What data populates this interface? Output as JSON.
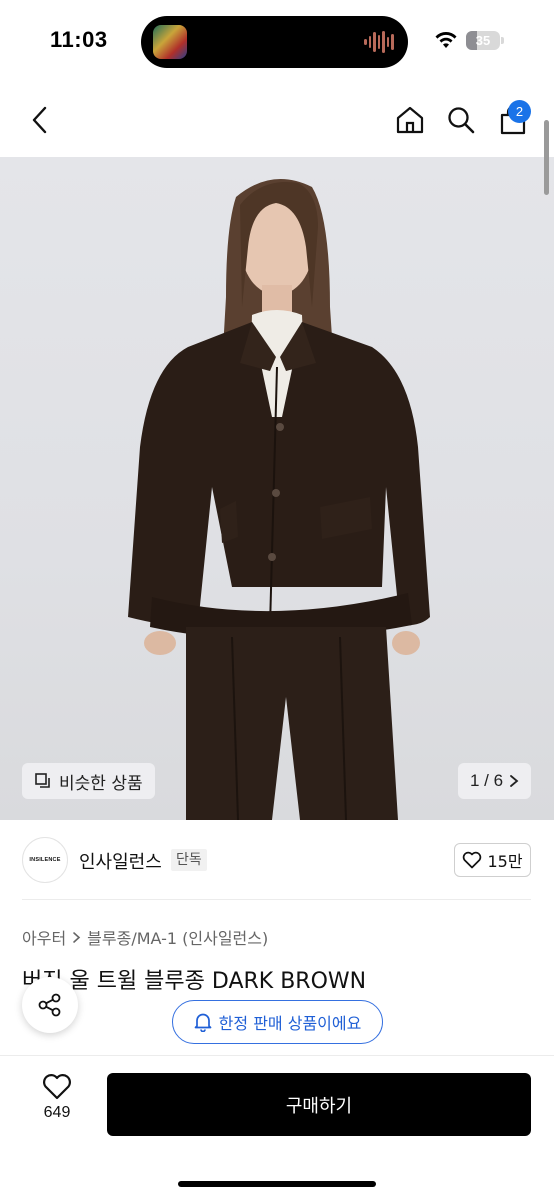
{
  "status_bar": {
    "time": "11:03",
    "battery": "35"
  },
  "nav": {
    "cart_count": "2"
  },
  "gallery": {
    "similar_label": "비슷한 상품",
    "page_indicator": "1 / 6"
  },
  "brand": {
    "logo_text": "INSILENCE",
    "name": "인사일런스",
    "badge": "단독",
    "likes": "15만"
  },
  "product": {
    "breadcrumb": [
      "아우터",
      "블루종/MA-1 (인사일런스)"
    ],
    "title": "버진 울 트윌 블루종 DARK BROWN"
  },
  "limited_notice": "한정 판매 상품이에요",
  "bottom": {
    "wish_count": "649",
    "buy_label": "구매하기"
  },
  "colors": {
    "accent": "#1a73e8",
    "limited_blue": "#3570e0",
    "buy_button": "#000000",
    "jacket": "#2a1d16"
  }
}
